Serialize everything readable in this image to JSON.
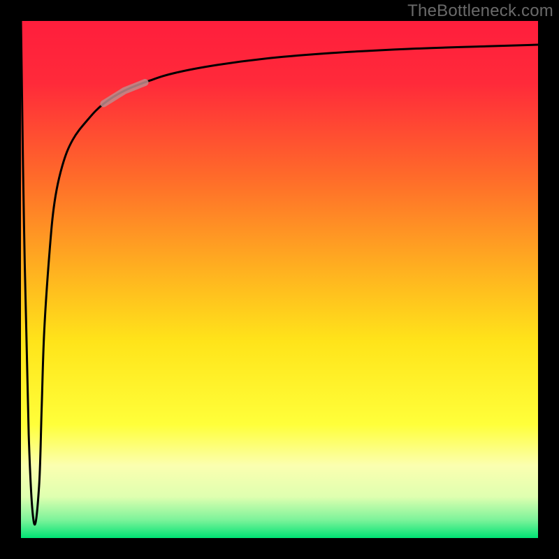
{
  "watermark": "TheBottleneck.com",
  "chart_data": {
    "type": "line",
    "title": "",
    "xlabel": "",
    "ylabel": "",
    "xlim": [
      0,
      100
    ],
    "ylim": [
      0,
      100
    ],
    "background_gradient_stops": [
      {
        "offset": 0.0,
        "color": "#ff1e3c"
      },
      {
        "offset": 0.12,
        "color": "#ff2a3a"
      },
      {
        "offset": 0.3,
        "color": "#ff6a2a"
      },
      {
        "offset": 0.48,
        "color": "#ffb020"
      },
      {
        "offset": 0.62,
        "color": "#ffe41a"
      },
      {
        "offset": 0.78,
        "color": "#ffff3a"
      },
      {
        "offset": 0.86,
        "color": "#fbffb0"
      },
      {
        "offset": 0.92,
        "color": "#dfffb0"
      },
      {
        "offset": 0.965,
        "color": "#7cf39a"
      },
      {
        "offset": 1.0,
        "color": "#00e374"
      }
    ],
    "series": [
      {
        "name": "bottleneck-curve",
        "x": [
          0.0,
          0.6,
          1.5,
          2.5,
          3.5,
          4.0,
          4.5,
          5.5,
          6.5,
          8,
          10,
          13,
          16,
          20,
          25,
          30,
          38,
          48,
          60,
          75,
          90,
          100
        ],
        "y": [
          100,
          60,
          20,
          3,
          10,
          25,
          40,
          55,
          65,
          72,
          77,
          81,
          84,
          86.5,
          88.5,
          90,
          91.5,
          92.8,
          93.8,
          94.6,
          95.1,
          95.4
        ]
      }
    ],
    "highlight_segment": {
      "x_start": 16,
      "x_end": 24
    }
  }
}
